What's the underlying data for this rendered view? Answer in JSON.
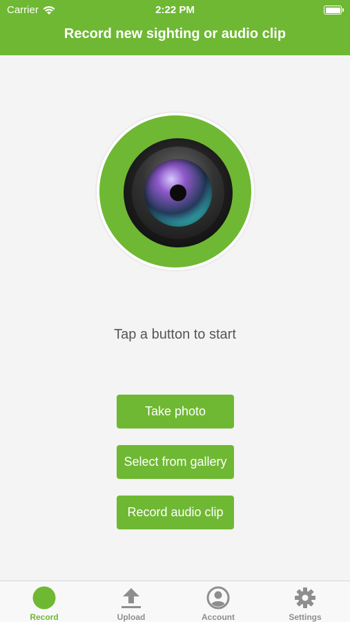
{
  "status_bar": {
    "carrier": "Carrier",
    "time": "2:22 PM"
  },
  "header": {
    "title": "Record new sighting or audio clip"
  },
  "main": {
    "image": "camera-lens-icon",
    "prompt": "Tap a button to start",
    "buttons": {
      "take_photo": "Take photo",
      "select_gallery": "Select from gallery",
      "record_audio": "Record audio clip"
    }
  },
  "tabbar": {
    "tabs": [
      {
        "label": "Record",
        "icon": "record-icon",
        "active": true
      },
      {
        "label": "Upload",
        "icon": "upload-icon",
        "active": false
      },
      {
        "label": "Account",
        "icon": "account-icon",
        "active": false
      },
      {
        "label": "Settings",
        "icon": "gear-icon",
        "active": false
      }
    ]
  },
  "colors": {
    "brand_green": "#6fb833",
    "inactive_gray": "#8e8e8e"
  }
}
